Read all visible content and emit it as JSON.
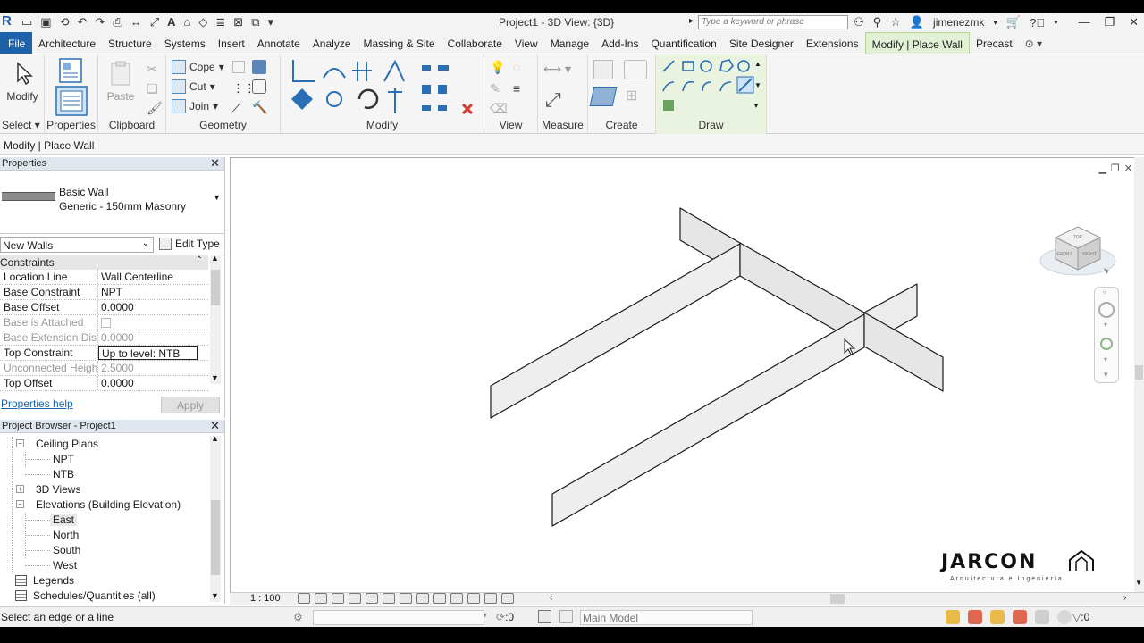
{
  "titlebar": {
    "app_logo": "R",
    "title": "Project1 - 3D View: {3D}",
    "search_placeholder": "Type a keyword or phrase",
    "user": "jimenezmk"
  },
  "tabs": [
    {
      "label": "File"
    },
    {
      "label": "Architecture"
    },
    {
      "label": "Structure"
    },
    {
      "label": "Systems"
    },
    {
      "label": "Insert"
    },
    {
      "label": "Annotate"
    },
    {
      "label": "Analyze"
    },
    {
      "label": "Massing & Site"
    },
    {
      "label": "Collaborate"
    },
    {
      "label": "View"
    },
    {
      "label": "Manage"
    },
    {
      "label": "Add-Ins"
    },
    {
      "label": "Quantification"
    },
    {
      "label": "Site Designer"
    },
    {
      "label": "Extensions"
    },
    {
      "label": "Modify | Place Wall"
    },
    {
      "label": "Precast"
    }
  ],
  "ribbon": {
    "modify_label": "Modify",
    "select_label": "Select",
    "properties_label": "Properties",
    "clipboard_label": "Clipboard",
    "paste_label": "Paste",
    "cope_label": "Cope",
    "cut_label": "Cut",
    "join_label": "Join",
    "geometry_label": "Geometry",
    "modify_panel_label": "Modify",
    "view_label": "View",
    "measure_label": "Measure",
    "create_label": "Create",
    "draw_label": "Draw"
  },
  "optionbar": {
    "context": "Modify | Place Wall"
  },
  "properties": {
    "header": "Properties",
    "type_family": "Basic Wall",
    "type_name": "Generic - 150mm Masonry",
    "filter": "New Walls",
    "edit_type": "Edit Type",
    "group": "Constraints",
    "rows": [
      {
        "key": "Location Line",
        "value": "Wall Centerline"
      },
      {
        "key": "Base Constraint",
        "value": "NPT"
      },
      {
        "key": "Base Offset",
        "value": "0.0000"
      },
      {
        "key": "Base is Attached",
        "value": ""
      },
      {
        "key": "Base Extension Dist...",
        "value": "0.0000"
      },
      {
        "key": "Top Constraint",
        "value": "Up to level: NTB"
      },
      {
        "key": "Unconnected Height",
        "value": "2.5000"
      },
      {
        "key": "Top Offset",
        "value": "0.0000"
      }
    ],
    "help_link": "Properties help",
    "apply": "Apply"
  },
  "browser": {
    "header": "Project Browser - Project1",
    "items": [
      {
        "label": "Ceiling Plans"
      },
      {
        "label": "NPT"
      },
      {
        "label": "NTB"
      },
      {
        "label": "3D Views"
      },
      {
        "label": "Elevations (Building Elevation)"
      },
      {
        "label": "East"
      },
      {
        "label": "North"
      },
      {
        "label": "South"
      },
      {
        "label": "West"
      },
      {
        "label": "Legends"
      },
      {
        "label": "Schedules/Quantities (all)"
      }
    ]
  },
  "viewcube": {
    "top": "TOP",
    "front": "FRONT",
    "right": "RIGHT"
  },
  "viewbar": {
    "scale": "1 : 100"
  },
  "statusbar": {
    "message": "Select an edge or a line",
    "count_left": ":0",
    "model": "Main Model",
    "count_right": ":0"
  },
  "watermark": {
    "name": "JARCON",
    "tagline": "Arquitectura e Ingeniería"
  }
}
